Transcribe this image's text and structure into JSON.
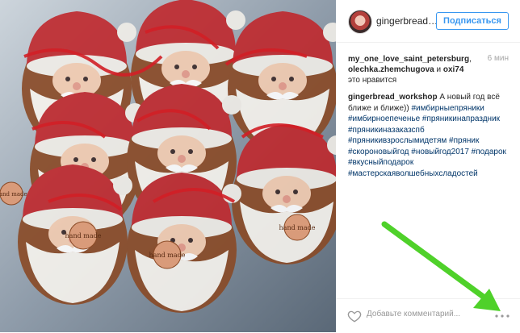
{
  "post": {
    "username": "gingerbread_workshop",
    "follow_label": "Подписаться",
    "likes_users": [
      "my_one_love_saint_petersburg",
      "olechka.zhemchugova",
      "oxi74"
    ],
    "likes_sep": ", ",
    "likes_and": " и ",
    "likes_suffix": " это нравится",
    "time": "6 мин",
    "caption_owner": "gingerbread_workshop",
    "caption_text": " А новый год всё ближе и ближе)) ",
    "hashtags": [
      "#имбирныепряники",
      "#имбирноепеченье",
      "#пряникинапраздник",
      "#пряникиназаказспб",
      "#пряникивзрослымидетям",
      "#пряник",
      "#скороновыйгод",
      "#новыйгод2017",
      "#подарок",
      "#вкусныйподарок",
      "#мастерскаяволшебныхсладостей"
    ],
    "comment_placeholder": "Добавьте комментарий...",
    "cookie_badge": "hand made"
  },
  "colors": {
    "accent": "#3897f0",
    "hashtag": "#003569",
    "santa_red": "#c0282d",
    "annotation_arrow": "#4fd12a"
  }
}
